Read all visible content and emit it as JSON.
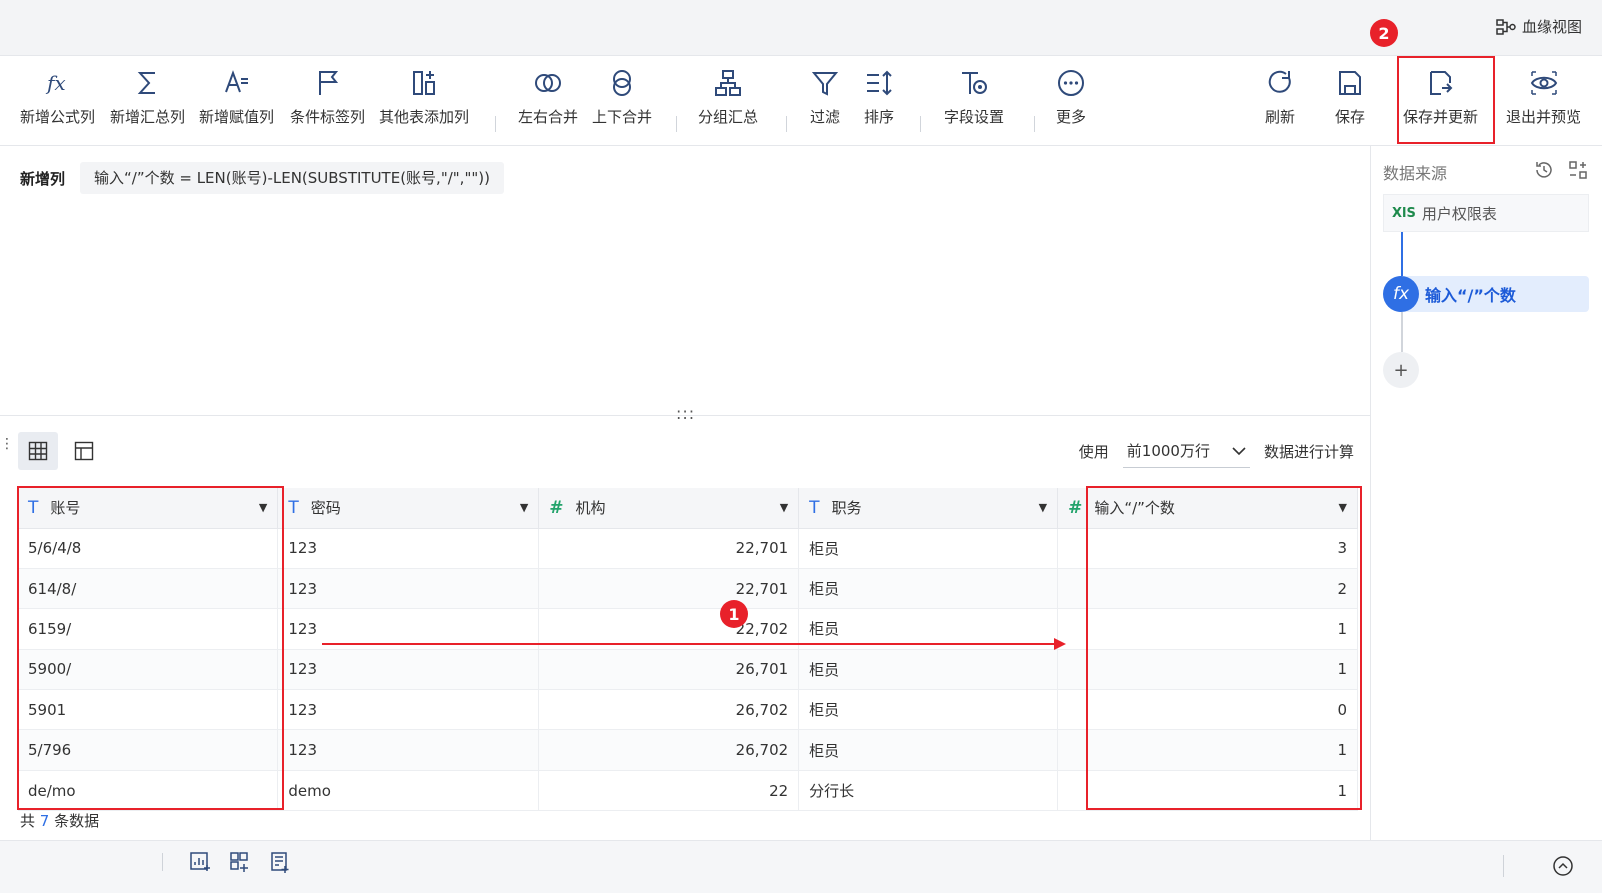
{
  "header": {
    "lineage_label": "血缘视图"
  },
  "toolbar": {
    "add_formula": "新增公式列",
    "add_summary": "新增汇总列",
    "add_assign": "新增赋值列",
    "add_condition": "条件标签列",
    "add_other": "其他表添加列",
    "merge_lr": "左右合并",
    "merge_ud": "上下合并",
    "group_summary": "分组汇总",
    "filter": "过滤",
    "sort": "排序",
    "field_settings": "字段设置",
    "more": "更多",
    "refresh": "刷新",
    "save": "保存",
    "save_update": "保存并更新",
    "exit_preview": "退出并预览"
  },
  "annotations": {
    "badge_1": "1",
    "badge_2": "2"
  },
  "formula": {
    "label": "新增列",
    "expression": "输入“/”个数 = LEN(账号)-LEN(SUBSTITUTE(账号,\"/\",\"\"))"
  },
  "drag_handle": ":::",
  "right_panel": {
    "title": "数据来源",
    "source_icon": "XlS",
    "source_name": "用户权限表",
    "step_name": "输入“/”个数",
    "add": "+"
  },
  "usage": {
    "use_label": "使用",
    "row_limit": "前1000万行",
    "compute_label": "数据进行计算"
  },
  "table": {
    "columns": [
      {
        "name": "账号",
        "type": "T"
      },
      {
        "name": "密码",
        "type": "T"
      },
      {
        "name": "机构",
        "type": "#"
      },
      {
        "name": "职务",
        "type": "T"
      },
      {
        "name": "输入“/”个数",
        "type": "#"
      }
    ],
    "rows": [
      [
        "5/6/4/8",
        "123",
        "22,701",
        "柜员",
        "3"
      ],
      [
        "614/8/",
        "123",
        "22,701",
        "柜员",
        "2"
      ],
      [
        "6159/",
        "123",
        "22,702",
        "柜员",
        "1"
      ],
      [
        "5900/",
        "123",
        "26,701",
        "柜员",
        "1"
      ],
      [
        "5901",
        "123",
        "26,702",
        "柜员",
        "0"
      ],
      [
        "5/796",
        "123",
        "26,702",
        "柜员",
        "1"
      ],
      [
        "de/mo",
        "demo",
        "22",
        "分行长",
        "1"
      ]
    ]
  },
  "footer": {
    "prefix": "共",
    "count": "7",
    "suffix": "条数据"
  },
  "colors": {
    "accent": "#2f6fe4",
    "highlight": "#e8212a",
    "number_type": "#22a36b"
  }
}
